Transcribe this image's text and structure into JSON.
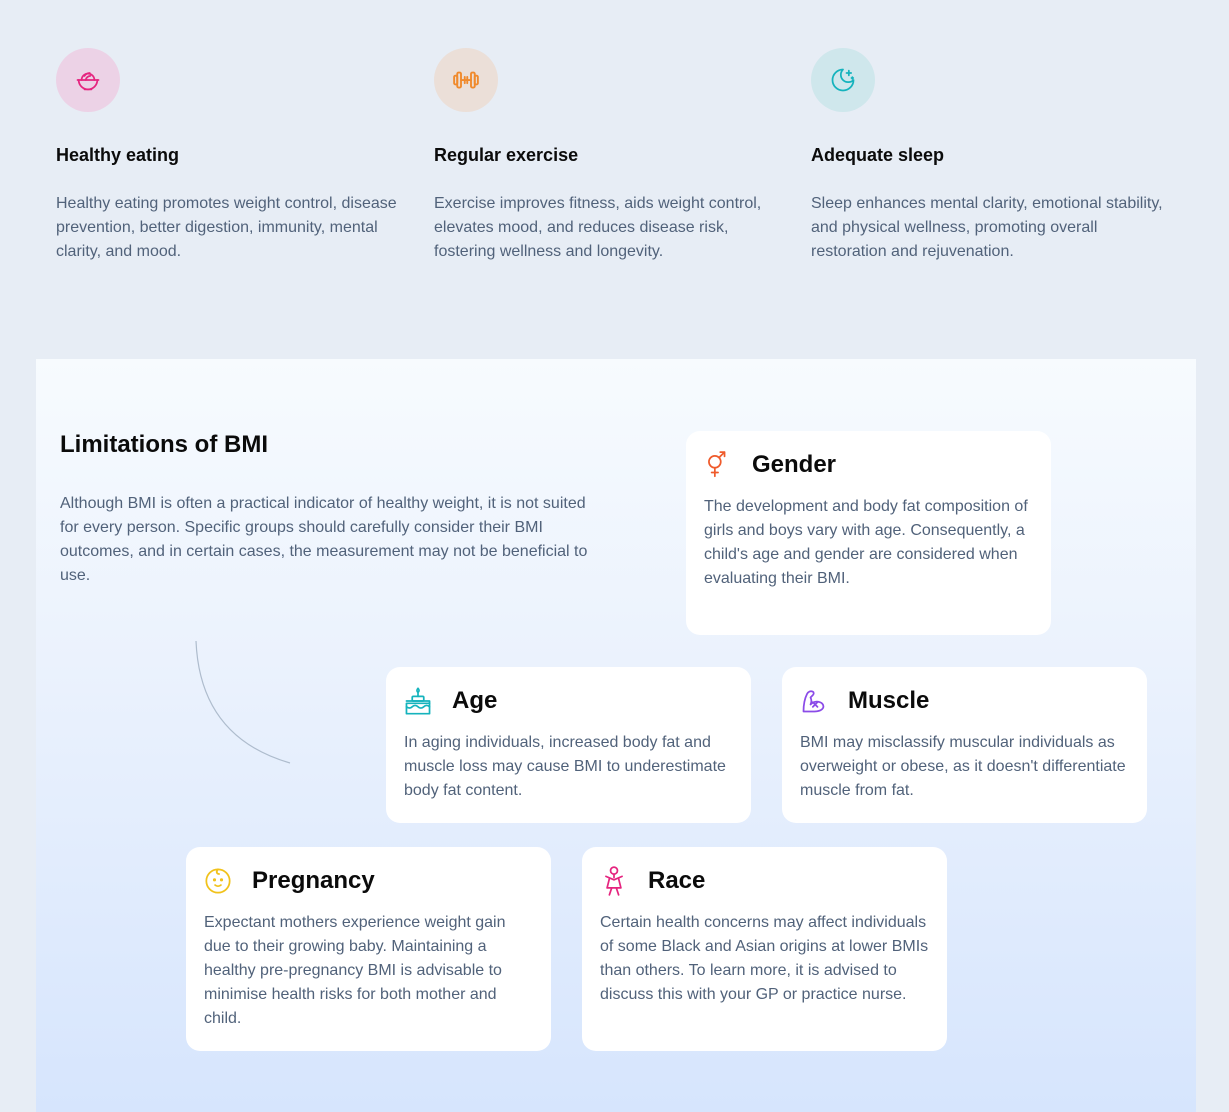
{
  "tips": [
    {
      "icon": "salad-bowl-icon",
      "icon_color": "#e5247f",
      "icon_bg": "#ecd2e6",
      "title": "Healthy eating",
      "text": "Healthy eating promotes weight control, disease prevention, better digestion, immunity, mental clarity, and mood."
    },
    {
      "icon": "dumbbell-icon",
      "icon_color": "#f08a2c",
      "icon_bg": "#ebdfd8",
      "title": "Regular exercise",
      "text": "Exercise improves fitness, aids weight control, elevates mood, and reduces disease risk, fostering wellness and longevity."
    },
    {
      "icon": "moon-stars-icon",
      "icon_color": "#15b3bd",
      "icon_bg": "#cfe7ec",
      "title": "Adequate sleep",
      "text": "Sleep enhances mental clarity, emotional stability, and physical wellness, promoting overall restoration and rejuvenation."
    }
  ],
  "limitations": {
    "title": "Limitations of BMI",
    "text": "Although BMI is often a practical indicator of healthy weight, it is not suited for every person. Specific groups should carefully consider their BMI outcomes, and in certain cases, the measurement may not be beneficial to use.",
    "cards": [
      {
        "icon": "gender-icon",
        "icon_color": "#ef5b2c",
        "title": "Gender",
        "text": "The development and body fat composition of girls and boys vary with age. Consequently, a child's age and gender are considered when evaluating their BMI."
      },
      {
        "icon": "birthday-cake-icon",
        "icon_color": "#15b3bd",
        "title": "Age",
        "text": "In aging individuals, increased body fat and muscle loss may cause BMI to underestimate body fat content."
      },
      {
        "icon": "flexed-arm-icon",
        "icon_color": "#8b4be8",
        "title": "Muscle",
        "text": "BMI may misclassify muscular individuals as overweight or obese, as it doesn't differentiate muscle from fat."
      },
      {
        "icon": "baby-face-icon",
        "icon_color": "#f1c21b",
        "title": "Pregnancy",
        "text": "Expectant mothers experience weight gain due to their growing baby. Maintaining a healthy pre-pregnancy BMI is advisable to minimise health risks for both mother and child."
      },
      {
        "icon": "person-icon",
        "icon_color": "#e5247f",
        "title": "Race",
        "text": "Certain health concerns may affect individuals of some Black and Asian origins at lower BMIs than others. To learn more, it is advised to discuss this with your GP or practice nurse."
      }
    ]
  }
}
